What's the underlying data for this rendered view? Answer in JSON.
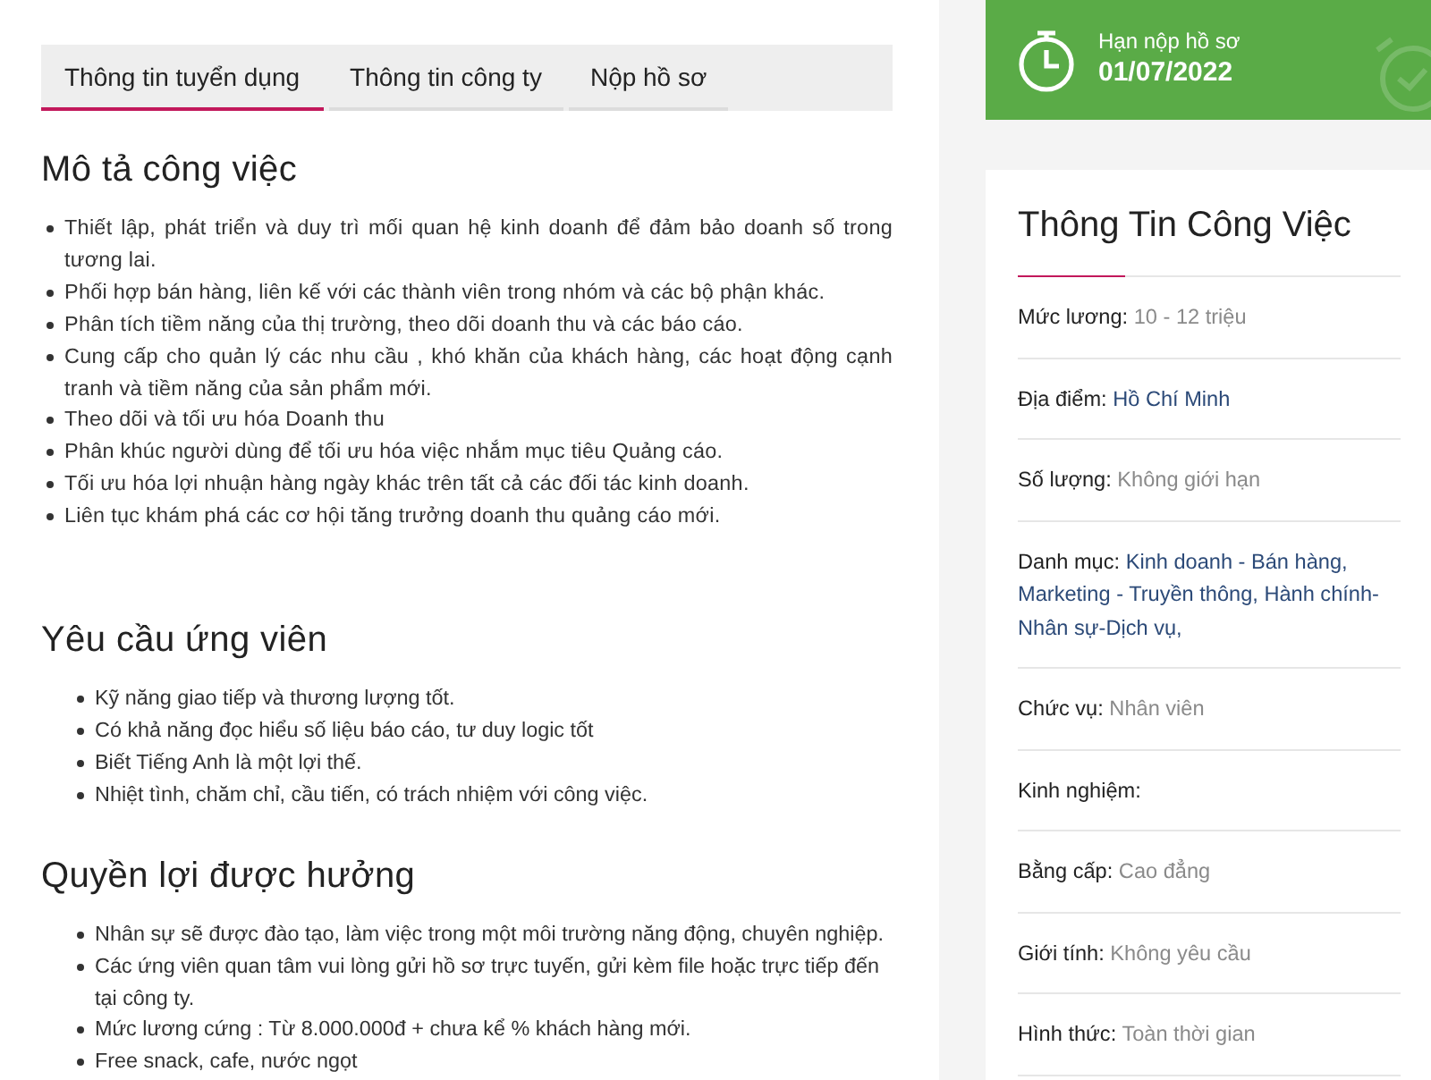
{
  "tabs": [
    {
      "label": "Thông tin tuyển dụng",
      "selected": true
    },
    {
      "label": "Thông tin công ty",
      "selected": false
    },
    {
      "label": "Nộp hồ sơ",
      "selected": false
    }
  ],
  "sections": [
    {
      "title": "Mô tả công việc",
      "kind": "justified",
      "items": [
        "Thiết lập, phát triển và duy trì mối quan hệ kinh doanh để đảm bảo doanh số trong tương lai.",
        "Phối hợp bán hàng, liên kế với các thành viên trong nhóm và các bộ phận khác.",
        "Phân tích tiềm năng của thị trường, theo dõi doanh thu và các báo cáo.",
        "Cung cấp cho quản lý các nhu cầu , khó khăn của khách hàng, các hoạt động cạnh tranh và tiềm năng của sản phẩm mới.",
        "Theo dõi và tối ưu hóa Doanh thu",
        "Phân khúc người dùng để tối ưu hóa việc nhắm mục tiêu Quảng cáo.",
        "Tối ưu hóa lợi nhuận hàng ngày khác trên tất cả các đối tác kinh doanh.",
        "Liên tục khám phá các cơ hội tăng trưởng doanh thu quảng cáo mới."
      ]
    },
    {
      "title": "Yêu cầu ứng viên",
      "kind": "indented",
      "items": [
        "Kỹ năng giao tiếp và thương lượng tốt.",
        "Có khả năng đọc hiểu số liệu báo cáo, tư duy logic tốt",
        "Biết Tiếng Anh là một lợi thế.",
        "Nhiệt tình, chăm chỉ, cầu tiến, có trách nhiệm với công việc."
      ]
    },
    {
      "title": "Quyền lợi được hưởng",
      "kind": "indented",
      "items": [
        "Nhân sự sẽ được đào tạo, làm việc trong một môi trường năng động, chuyên nghiệp.",
        "Các ứng viên quan tâm vui lòng gửi hồ sơ trực tuyến, gửi kèm file hoặc trực tiếp đến tại công ty.",
        "Mức lương cứng : Từ 8.000.000đ + chưa kể % khách hàng mới.",
        "Free snack, cafe, nước ngọt"
      ]
    }
  ],
  "deadline": {
    "label": "Hạn nộp hồ sơ",
    "date": "01/07/2022"
  },
  "job_info": {
    "title": "Thông Tin Công Việc",
    "rows": [
      {
        "label": "Mức lương:",
        "value": "10 - 12 triệu",
        "kind": "text"
      },
      {
        "label": "Địa điểm:",
        "value": "Hồ Chí Minh",
        "kind": "link"
      },
      {
        "label": "Số lượng:",
        "value": "Không giới hạn",
        "kind": "text"
      },
      {
        "label": "Danh mục:",
        "value": "Kinh doanh - Bán hàng, Marketing - Truyền thông, Hành chính-Nhân sự-Dịch vụ,",
        "kind": "link"
      },
      {
        "label": "Chức vụ:",
        "value": "Nhân viên",
        "kind": "text"
      },
      {
        "label": "Kinh nghiệm:"
      },
      {
        "label": "Bằng cấp:",
        "value": "Cao đẳng",
        "kind": "text"
      },
      {
        "label": "Giới tính:",
        "value": "Không yêu cầu",
        "kind": "text"
      },
      {
        "label": "Hình thức:",
        "value": "Toàn thời gian",
        "kind": "text"
      }
    ]
  }
}
